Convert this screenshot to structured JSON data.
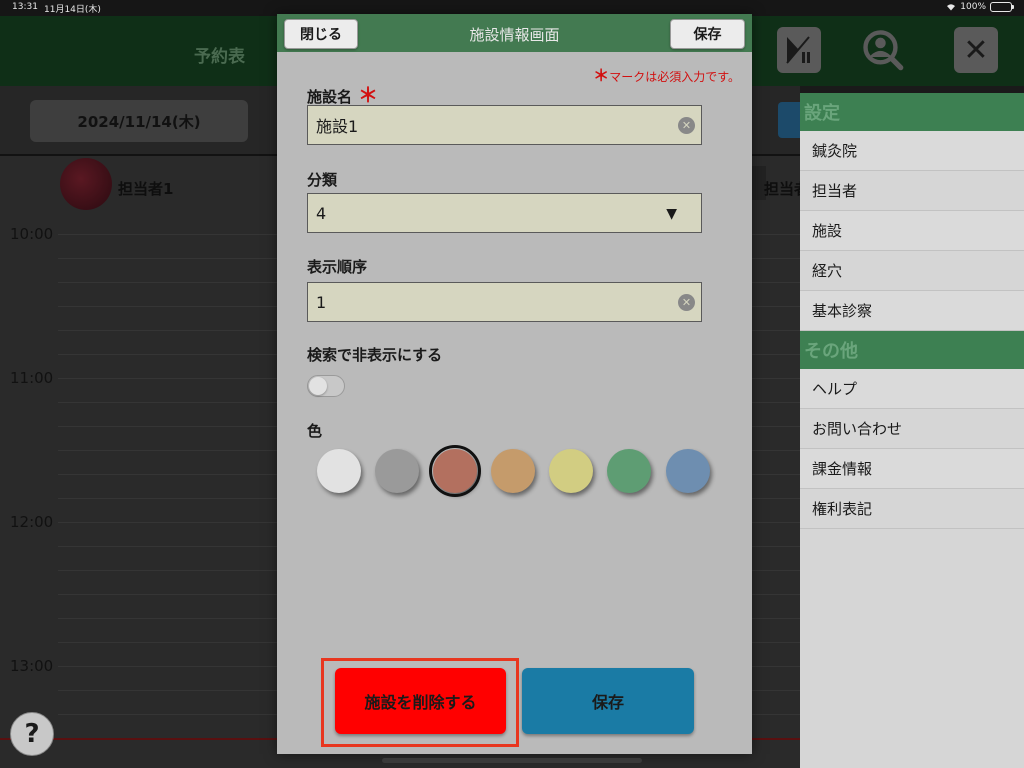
{
  "status_bar": {
    "time": "13:31",
    "date": "11月14日(木)",
    "battery": "100%"
  },
  "background": {
    "title": "予約表",
    "date_button": "2024/11/14(木)",
    "staff": [
      "担当者1",
      "担当者"
    ],
    "times": [
      "10:00",
      "11:00",
      "12:00",
      "13:00"
    ],
    "help_label": "?"
  },
  "settings_menu": {
    "section1": "設定",
    "items1": [
      "鍼灸院",
      "担当者",
      "施設",
      "経穴",
      "基本診察"
    ],
    "section2": "その他",
    "items2": [
      "ヘルプ",
      "お問い合わせ",
      "課金情報",
      "権利表記"
    ]
  },
  "modal": {
    "title": "施設情報画面",
    "close_label": "閉じる",
    "save_label": "保存",
    "required_mark": "＊",
    "required_note": "マークは必須入力です。",
    "name_label": "施設名",
    "name_required": "＊",
    "name_value": "施設1",
    "category_label": "分類",
    "category_value": "4",
    "order_label": "表示順序",
    "order_value": "1",
    "hide_label": "検索で非表示にする",
    "hide_enabled": false,
    "color_label": "色",
    "colors": [
      "#e2e2e2",
      "#9a9a9a",
      "#b3705f",
      "#c59b6b",
      "#d2cd82",
      "#5e9d73",
      "#6e8eb0"
    ],
    "selected_color_index": 2,
    "delete_label": "施設を削除する",
    "footer_save_label": "保存"
  }
}
